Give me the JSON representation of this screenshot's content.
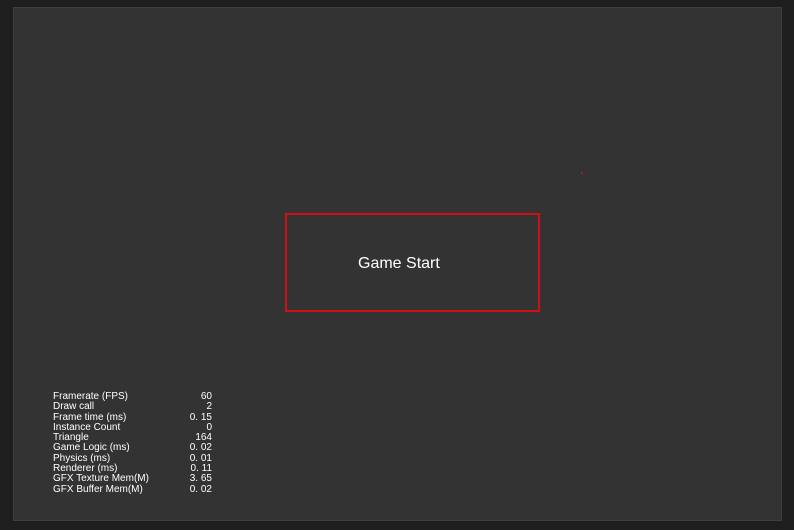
{
  "game": {
    "start_button_label": "Game Start"
  },
  "stats": [
    {
      "label": "Framerate (FPS)",
      "value": "60"
    },
    {
      "label": "Draw call",
      "value": "2"
    },
    {
      "label": "Frame time (ms)",
      "value": "0. 15"
    },
    {
      "label": "Instance Count",
      "value": "0"
    },
    {
      "label": "Triangle",
      "value": "164"
    },
    {
      "label": "Game Logic (ms)",
      "value": "0. 02"
    },
    {
      "label": "Physics (ms)",
      "value": "0. 01"
    },
    {
      "label": "Renderer (ms)",
      "value": "0. 11"
    },
    {
      "label": "GFX Texture Mem(M)",
      "value": "3. 65"
    },
    {
      "label": "GFX Buffer Mem(M)",
      "value": "0. 02"
    }
  ],
  "colors": {
    "background": "#333333",
    "button_border": "#d10f16",
    "text": "#ffffff"
  }
}
